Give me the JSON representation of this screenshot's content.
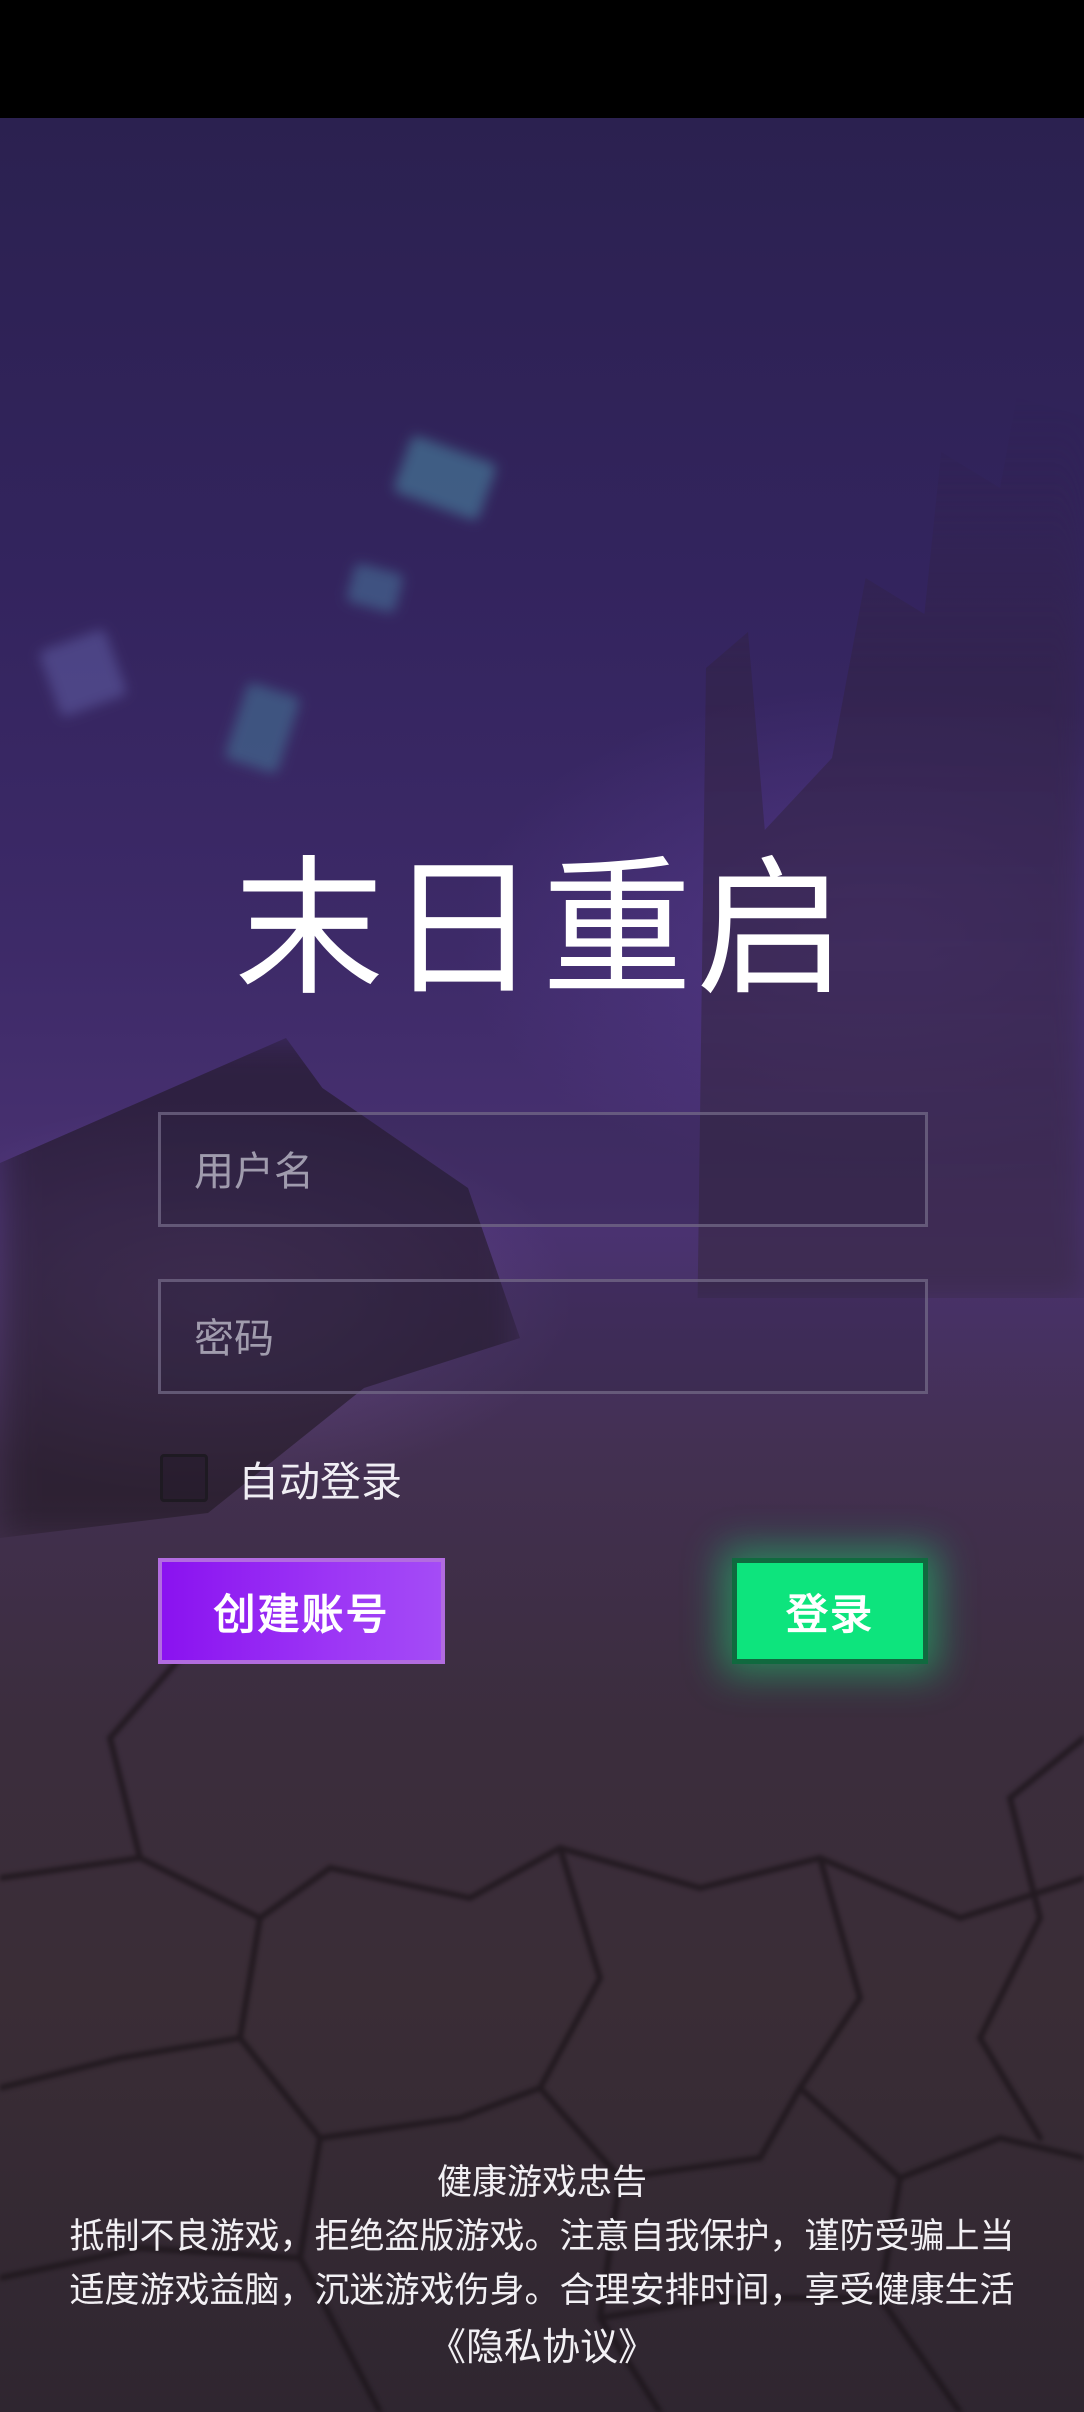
{
  "game_title": "末日重启",
  "username": {
    "placeholder": "用户名",
    "value": ""
  },
  "password": {
    "placeholder": "密码",
    "value": ""
  },
  "auto_login": {
    "label": "自动登录",
    "checked": false
  },
  "buttons": {
    "create_account": "创建账号",
    "login": "登录"
  },
  "health_notice": {
    "title": "健康游戏忠告",
    "line1": "抵制不良游戏，拒绝盗版游戏。注意自我保护，谨防受骗上当",
    "line2": "适度游戏益脑，沉迷游戏伤身。合理安排时间，享受健康生活"
  },
  "privacy_link": "《隐私协议》",
  "colors": {
    "create_button": "#8a12f0",
    "login_button": "#0de47d",
    "status_bar": "#000000"
  }
}
